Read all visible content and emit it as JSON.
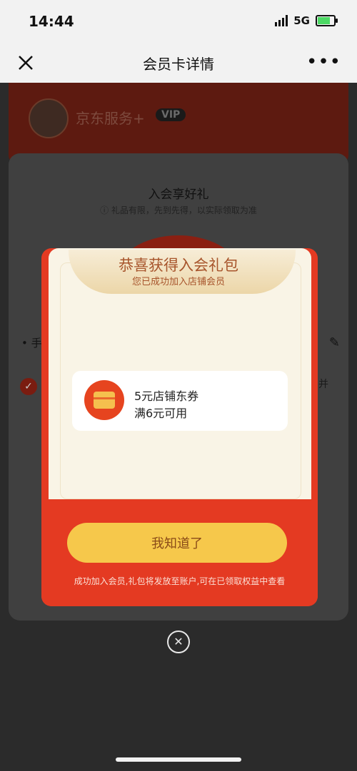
{
  "status_bar": {
    "time": "14:44",
    "network": "5G"
  },
  "navbar": {
    "title": "会员卡详情",
    "more": "•••"
  },
  "background": {
    "shop_name": "京东服务+",
    "vip_badge": "VIP",
    "benefit_title": "入会享好礼",
    "benefit_note": "ⓘ 礼品有限，先到先得，以实际领取为准",
    "phone_label": "• 手",
    "suffix_text": "并"
  },
  "modal": {
    "title": "恭喜获得入会礼包",
    "subtitle": "您已成功加入店铺会员",
    "coupon": {
      "name": "5元店铺东券",
      "condition": "满6元可用"
    },
    "confirm_label": "我知道了",
    "footer_note": "成功加入会员,礼包将发放至账户,可在已领取权益中查看"
  },
  "close_symbol": "✕"
}
